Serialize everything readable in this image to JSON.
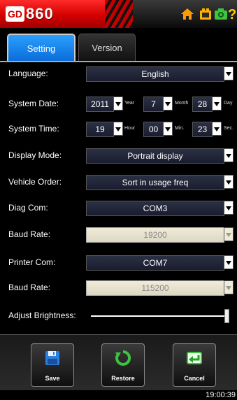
{
  "header": {
    "logo_box": "GD",
    "logo_text": "860"
  },
  "tabs": [
    {
      "label": "Setting"
    },
    {
      "label": "Version"
    }
  ],
  "settings": {
    "language": {
      "label": "Language:",
      "value": "English"
    },
    "system_date": {
      "label": "System Date:",
      "year": "2011",
      "year_unit": "Year",
      "month": "7",
      "month_unit": "Month",
      "day": "28",
      "day_unit": "Day"
    },
    "system_time": {
      "label": "System Time:",
      "hour": "19",
      "hour_unit": "Hour",
      "min": "00",
      "min_unit": "Min.",
      "sec": "23",
      "sec_unit": "Sec."
    },
    "display_mode": {
      "label": "Display Mode:",
      "value": "Portrait display"
    },
    "vehicle_order": {
      "label": "Vehicle Order:",
      "value": "Sort in usage freq"
    },
    "diag_com": {
      "label": "Diag Com:",
      "value": "COM3"
    },
    "baud_rate_1": {
      "label": "Baud Rate:",
      "value": "19200"
    },
    "printer_com": {
      "label": "Printer Com:",
      "value": "COM7"
    },
    "baud_rate_2": {
      "label": "Baud Rate:",
      "value": "115200"
    },
    "brightness": {
      "label": "Adjust Brightness:",
      "level": 1.0
    }
  },
  "footer": {
    "save": "Save",
    "restore": "Restore",
    "cancel": "Cancel"
  },
  "status": {
    "clock": "19:00:39"
  },
  "colors": {
    "brand_red": "#d40000",
    "tab_blue": "#0a6bd8"
  }
}
